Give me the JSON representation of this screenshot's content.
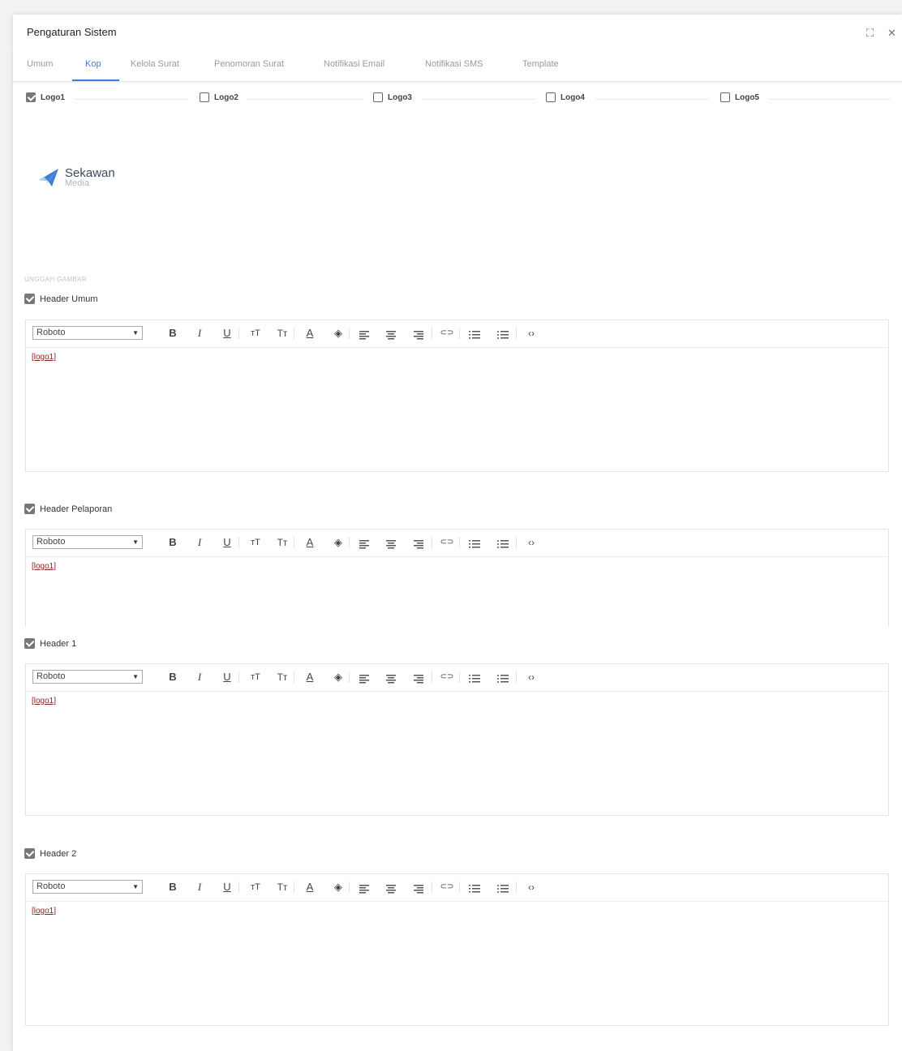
{
  "window": {
    "title": "Pengaturan Sistem",
    "expand_glyph": "⛶",
    "close_glyph": "✕"
  },
  "tabs": [
    {
      "label": "Umum"
    },
    {
      "label": "Kop"
    },
    {
      "label": "Kelola Surat"
    },
    {
      "label": "Penomoran Surat"
    },
    {
      "label": "Notifikasi Email"
    },
    {
      "label": "Notifikasi SMS"
    },
    {
      "label": "Template"
    }
  ],
  "logos": [
    {
      "label": "Logo1",
      "checked": true
    },
    {
      "label": "Logo2",
      "checked": false
    },
    {
      "label": "Logo3",
      "checked": false
    },
    {
      "label": "Logo4",
      "checked": false
    },
    {
      "label": "Logo5",
      "checked": false
    }
  ],
  "brand": {
    "name": "Sekawan",
    "sub": "Media",
    "color": "#3e7fd5"
  },
  "upload_label": "UNGGAH GAMBAR",
  "sections": [
    {
      "label": "Header Umum",
      "checked": true,
      "font": "Roboto",
      "content": "[logo1]"
    },
    {
      "label": "Header Pelaporan",
      "checked": true,
      "font": "Roboto",
      "content": "[logo1]"
    },
    {
      "label": "Header 1",
      "checked": true,
      "font": "Roboto",
      "content": "[logo1]"
    },
    {
      "label": "Header 2",
      "checked": true,
      "font": "Roboto",
      "content": "[logo1]"
    }
  ],
  "toolbar": {
    "bold": "B",
    "italic": "I",
    "underline": "U",
    "superscript": "ᴛT",
    "font_size": "Tт",
    "text_color": "A",
    "highlight": "◈",
    "link": "⊂⊃",
    "code": "‹›"
  },
  "colors": {
    "accent": "#3e7fd5",
    "content_text": "#8a2424"
  }
}
